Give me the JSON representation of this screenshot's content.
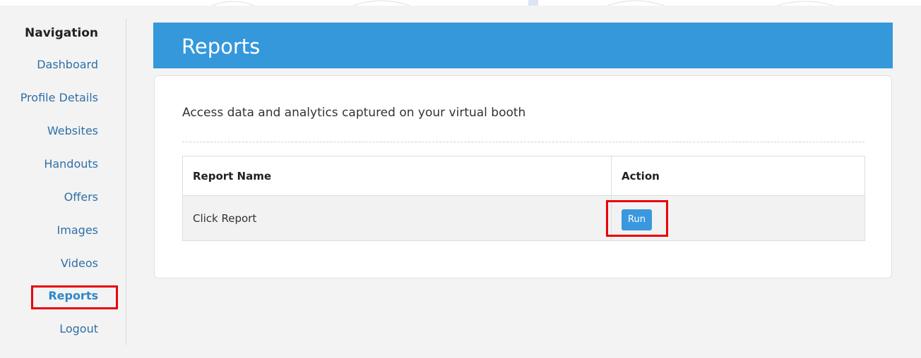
{
  "sidebar": {
    "heading": "Navigation",
    "items": [
      {
        "label": "Dashboard"
      },
      {
        "label": "Profile Details"
      },
      {
        "label": "Websites"
      },
      {
        "label": "Handouts"
      },
      {
        "label": "Offers"
      },
      {
        "label": "Images"
      },
      {
        "label": "Videos"
      },
      {
        "label": "Reports",
        "active": true
      },
      {
        "label": "Logout"
      }
    ]
  },
  "header": {
    "title": "Reports"
  },
  "main": {
    "description": "Access data and analytics captured on your virtual booth",
    "table": {
      "columns": [
        "Report Name",
        "Action"
      ],
      "rows": [
        {
          "name": "Click Report",
          "action_label": "Run"
        }
      ]
    }
  },
  "colors": {
    "accent": "#3498db",
    "link": "#2f6fa7",
    "active_link": "#2f86c9",
    "annotation": "#e8000b",
    "button": "#3b97df"
  }
}
